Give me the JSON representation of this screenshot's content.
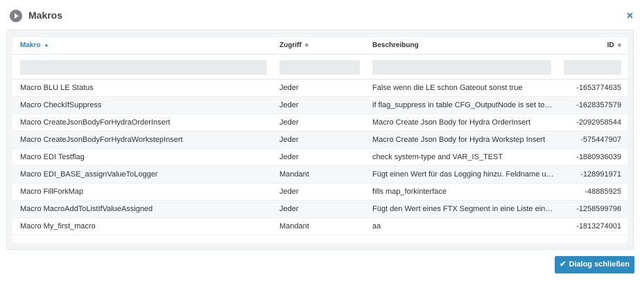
{
  "dialog": {
    "title": "Makros",
    "close_button_label": "Dialog schließen"
  },
  "table": {
    "columns": [
      {
        "label": "Makro",
        "sort": "▲"
      },
      {
        "label": "Zugriff",
        "sort": "◆"
      },
      {
        "label": "Beschreibung",
        "sort": ""
      },
      {
        "label": "ID",
        "sort": "◆"
      }
    ],
    "rows": [
      {
        "makro": "Macro BLU LE Status",
        "zugriff": "Jeder",
        "beschreibung": "False wenn die LE schon Gateout sonst true",
        "id": "-1653774635"
      },
      {
        "makro": "Macro CheckIfSuppress",
        "zugriff": "Jeder",
        "beschreibung": "if flag_suppress in table CFG_OutputNode is set to true",
        "id": "-1628357579"
      },
      {
        "makro": "Macro CreateJsonBodyForHydraOrderInsert",
        "zugriff": "Jeder",
        "beschreibung": "Macro Create Json Body for Hydra OrderInsert",
        "id": "-2092958544"
      },
      {
        "makro": "Macro CreateJsonBodyForHydraWorkstepInsert",
        "zugriff": "Jeder",
        "beschreibung": "Macro Create Json Body for Hydra Workstep Insert",
        "id": "-575447907"
      },
      {
        "makro": "Macro EDI Testflag",
        "zugriff": "Jeder",
        "beschreibung": "check system-type and VAR_IS_TEST",
        "id": "-1880936039"
      },
      {
        "makro": "Macro EDI_BASE_assignValueToLogger",
        "zugriff": "Mandant",
        "beschreibung": "Fügt einen Wert für das Logging hinzu. Feldname und Wert",
        "id": "-128991971"
      },
      {
        "makro": "Macro FillForkMap",
        "zugriff": "Jeder",
        "beschreibung": "fills map_forkinterface",
        "id": "-48885925"
      },
      {
        "makro": "Macro MacroAddToListIfValueAssigned",
        "zugriff": "Jeder",
        "beschreibung": "Fügt den Wert eines FTX Segment in eine Liste ein, wenn",
        "id": "-1258599796"
      },
      {
        "makro": "Macro My_first_macro",
        "zugriff": "Mandant",
        "beschreibung": "aa",
        "id": "-1813274001"
      }
    ]
  }
}
